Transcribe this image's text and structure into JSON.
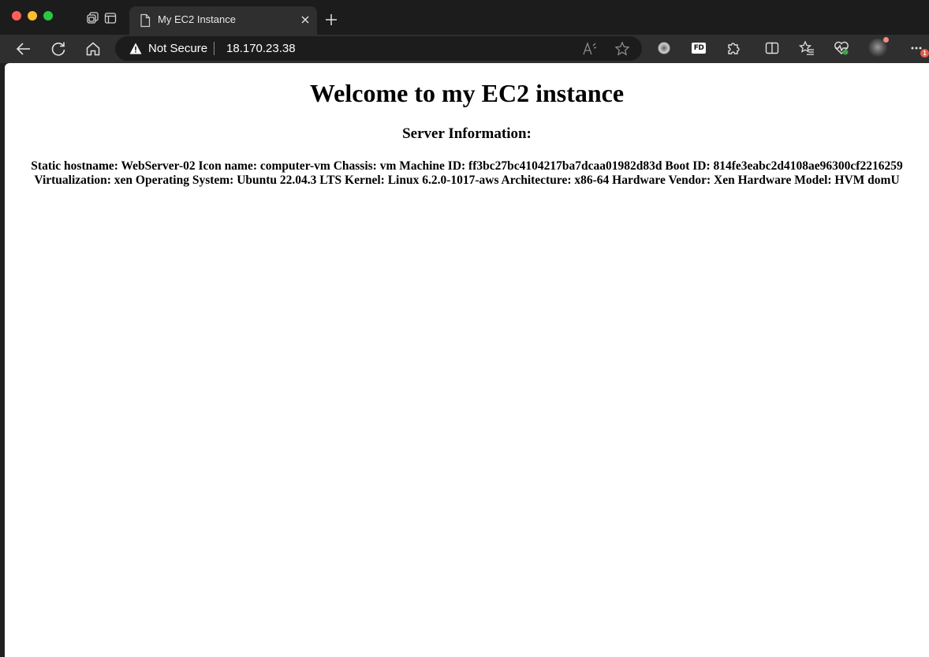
{
  "browser": {
    "tab": {
      "title": "My EC2 Instance"
    },
    "address_bar": {
      "security_label": "Not Secure",
      "url": "18.170.23.38"
    },
    "notification_count": "1",
    "colors": {
      "close": "#ff5f57",
      "minimize": "#febc2e",
      "maximize": "#28c840",
      "toolbar_bg": "#2f2f2f",
      "tabbar_bg": "#1c1c1c"
    },
    "icons": {
      "tabs": "tab-actions-icon",
      "vertical_tabs": "vertical-tabs-icon",
      "tab_page": "document-icon",
      "close_tab": "close-icon",
      "new_tab": "plus-icon",
      "back": "back-arrow-icon",
      "refresh": "refresh-icon",
      "home": "home-icon",
      "warning": "warning-icon",
      "read_aloud": "read-aloud-icon",
      "add_favorite": "star-icon",
      "extension_1": "extension-circle-icon",
      "extension_fd": "fd-extension-icon",
      "extensions": "puzzle-icon",
      "split_screen": "split-screen-icon",
      "favorites": "favorites-icon",
      "browser_essentials": "heart-pulse-icon",
      "profile": "avatar",
      "more": "more-icon"
    }
  },
  "page": {
    "heading": "Welcome to my EC2 instance",
    "subheading": "Server Information:",
    "info_text": "Static hostname: WebServer-02 Icon name: computer-vm Chassis: vm Machine ID: ff3bc27bc4104217ba7dcaa01982d83d Boot ID: 814fe3eabc2d4108ae96300cf2216259 Virtualization: xen Operating System: Ubuntu 22.04.3 LTS Kernel: Linux 6.2.0-1017-aws Architecture: x86-64 Hardware Vendor: Xen Hardware Model: HVM domU"
  }
}
